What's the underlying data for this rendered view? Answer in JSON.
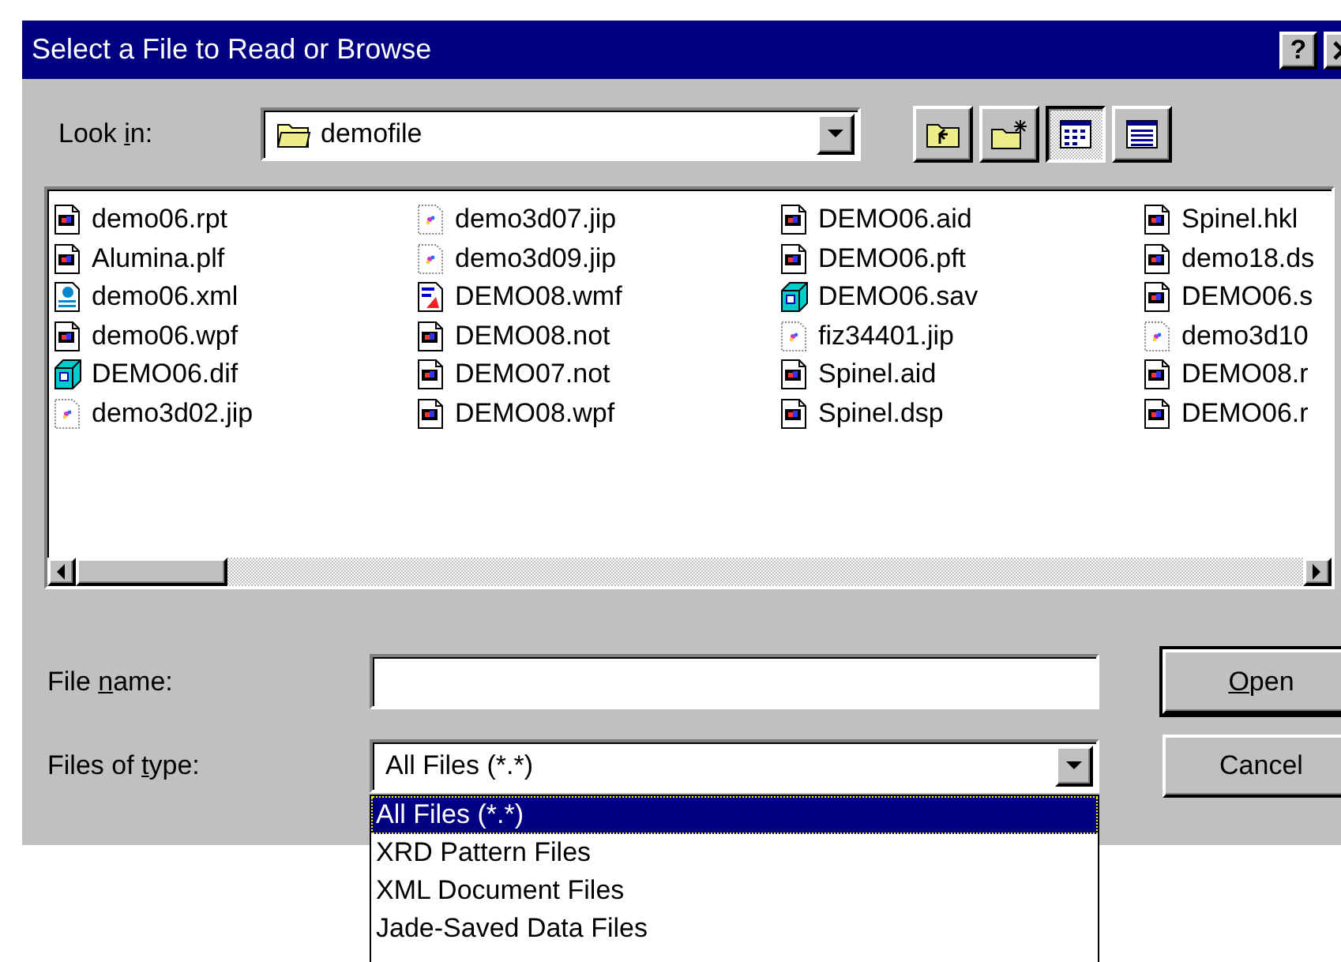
{
  "window": {
    "title": "Select a File to Read or Browse",
    "help_button": "?"
  },
  "look_in": {
    "label": [
      {
        "text": "Look ",
        "underlined": false
      },
      {
        "text": "i",
        "underlined": true
      },
      {
        "text": "n:",
        "underlined": false
      }
    ],
    "folder": "demofile"
  },
  "view_buttons": [
    {
      "kind": "list",
      "selected": true
    },
    {
      "kind": "details",
      "selected": false
    }
  ],
  "files": [
    {
      "name": "demo06.rpt",
      "kind": "document"
    },
    {
      "name": "Alumina.plf",
      "kind": "document"
    },
    {
      "name": "demo06.xml",
      "kind": "xml"
    },
    {
      "name": "demo06.wpf",
      "kind": "document"
    },
    {
      "name": "DEMO06.dif",
      "kind": "cube"
    },
    {
      "name": "demo3d02.jip",
      "kind": "dotted"
    },
    {
      "name": "demo3d07.jip",
      "kind": "dotted"
    },
    {
      "name": "demo3d09.jip",
      "kind": "dotted"
    },
    {
      "name": "DEMO08.wmf",
      "kind": "drawing"
    },
    {
      "name": "DEMO08.not",
      "kind": "document"
    },
    {
      "name": "DEMO07.not",
      "kind": "document"
    },
    {
      "name": "DEMO08.wpf",
      "kind": "document"
    },
    {
      "name": "DEMO06.aid",
      "kind": "document"
    },
    {
      "name": "DEMO06.pft",
      "kind": "document"
    },
    {
      "name": "DEMO06.sav",
      "kind": "cube"
    },
    {
      "name": "fiz34401.jip",
      "kind": "dotted"
    },
    {
      "name": "Spinel.aid",
      "kind": "document"
    },
    {
      "name": "Spinel.dsp",
      "kind": "document"
    },
    {
      "name": "Spinel.hkl",
      "kind": "document"
    },
    {
      "name": "demo18.ds",
      "kind": "document"
    },
    {
      "name": "DEMO06.s",
      "kind": "document"
    },
    {
      "name": "demo3d10",
      "kind": "dotted"
    },
    {
      "name": "DEMO08.r",
      "kind": "document"
    },
    {
      "name": "DEMO06.r",
      "kind": "document"
    }
  ],
  "file_name": {
    "label": [
      {
        "text": "File ",
        "underlined": false
      },
      {
        "text": "n",
        "underlined": true
      },
      {
        "text": "ame:",
        "underlined": false
      }
    ]
  },
  "file_type": {
    "label": [
      {
        "text": "Files of ",
        "underlined": false
      },
      {
        "text": "t",
        "underlined": true
      },
      {
        "text": "ype:",
        "underlined": false
      }
    ],
    "value": "All Files (*.*)",
    "options": [
      {
        "label": "All Files (*.*)",
        "selected": true
      },
      {
        "label": "XRD Pattern Files",
        "selected": false
      },
      {
        "label": "XML Document Files",
        "selected": false
      },
      {
        "label": "Jade-Saved Data Files",
        "selected": false
      }
    ]
  },
  "buttons": [
    {
      "label": [
        {
          "text": "O",
          "underlined": true
        },
        {
          "text": "pen",
          "underlined": false
        }
      ],
      "default": true
    },
    {
      "label": [
        {
          "text": "Cancel",
          "underlined": false
        }
      ],
      "default": false
    }
  ]
}
